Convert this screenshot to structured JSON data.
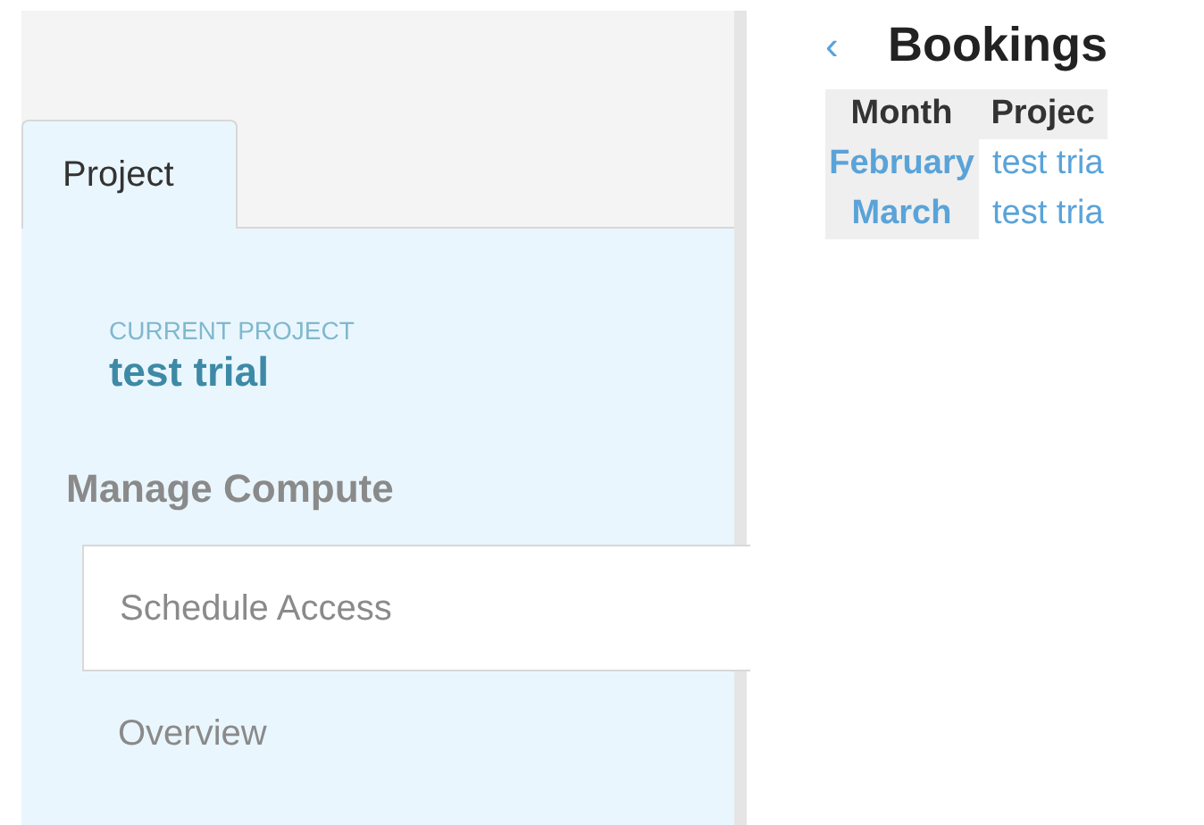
{
  "sidebar": {
    "tabs": [
      {
        "label": "Project",
        "selected": true
      }
    ],
    "current_project": {
      "label": "CURRENT PROJECT",
      "name": "test trial"
    },
    "section": "Manage Compute",
    "items": [
      {
        "label": "Schedule Access",
        "selected": true
      },
      {
        "label": "Overview",
        "selected": false
      }
    ]
  },
  "main": {
    "back": "‹",
    "title": "Bookings",
    "table": {
      "columns": [
        "Month",
        "Projec"
      ],
      "rows": [
        [
          "February",
          "test tria"
        ],
        [
          "March",
          "test tria"
        ]
      ]
    }
  }
}
